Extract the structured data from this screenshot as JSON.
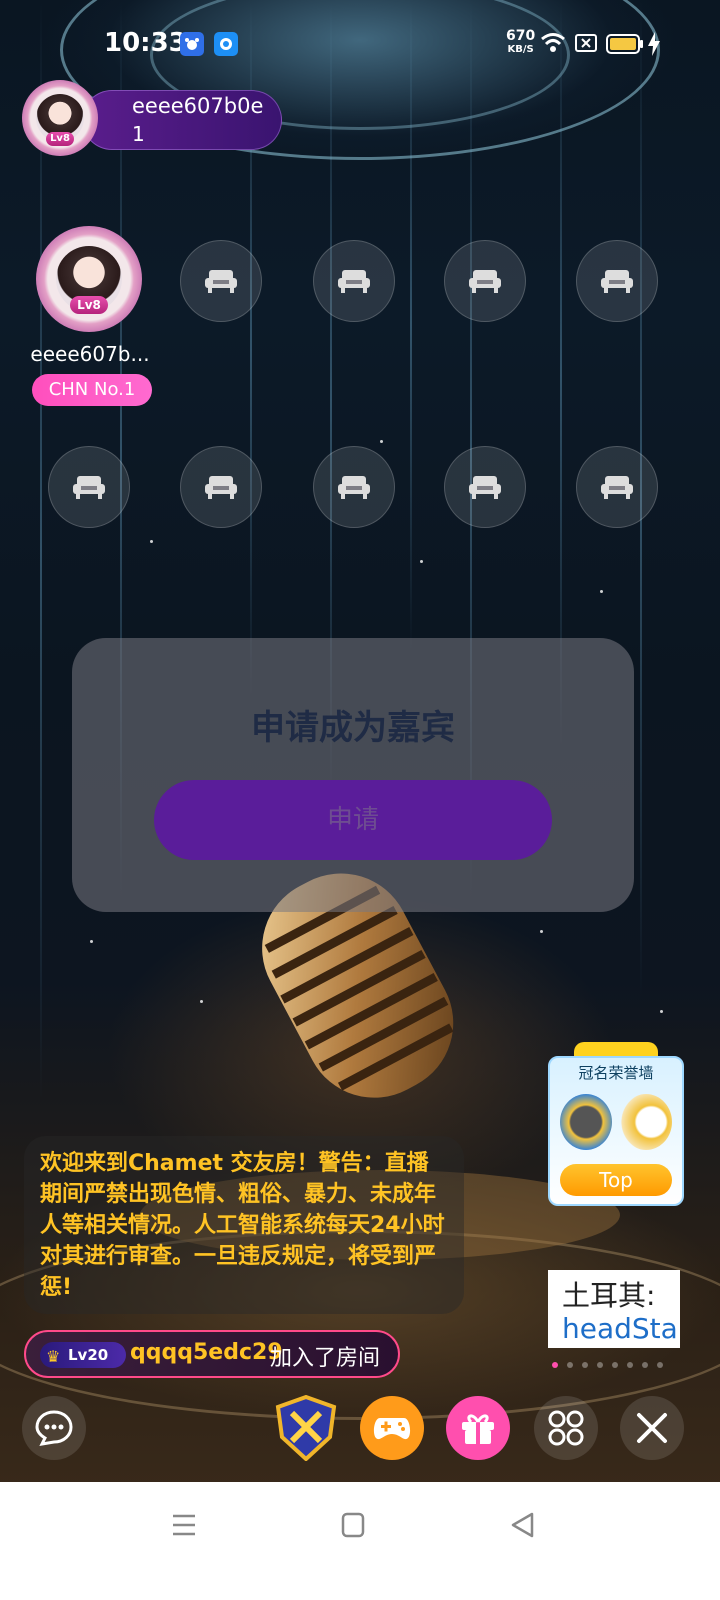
{
  "status_bar": {
    "time": "10:33",
    "net_speed_value": "670",
    "net_speed_unit": "KB/S",
    "icons": [
      "baidu-app-icon",
      "app-icon",
      "wifi-icon",
      "sim-icon",
      "battery-icon",
      "charging-icon"
    ]
  },
  "host": {
    "name": "eeee607b0e",
    "count": "1",
    "level": "Lv8"
  },
  "seats": {
    "occupied": {
      "name": "eeee607b...",
      "level": "Lv8",
      "badge": "CHN No.1"
    },
    "empty_icon": "sofa-icon"
  },
  "apply_card": {
    "title": "申请成为嘉宾",
    "button": "申请"
  },
  "chat": {
    "welcome": "欢迎来到Chamet 交友房！警告：直播期间严禁出现色情、粗俗、暴力、未成年人等相关情况。人工智能系统每天24小时对其进行审查。一旦违反规定，将受到严惩!",
    "join": {
      "level": "Lv20",
      "user": "qqqq5edc29",
      "text": "加入了房间"
    }
  },
  "honor_wall": {
    "title": "冠名荣誉墙",
    "button": "Top"
  },
  "news": {
    "line1": "土耳其:",
    "line2": "headSta"
  },
  "bottom_bar": {
    "icons": [
      "chat-icon",
      "battle-shield-icon",
      "game-controller-icon",
      "gift-icon",
      "more-apps-icon",
      "close-icon"
    ]
  },
  "colors": {
    "accent_pink": "#ff4fbd",
    "chat_yellow": "#ffc324",
    "apply_purple": "#5a1d9a"
  }
}
